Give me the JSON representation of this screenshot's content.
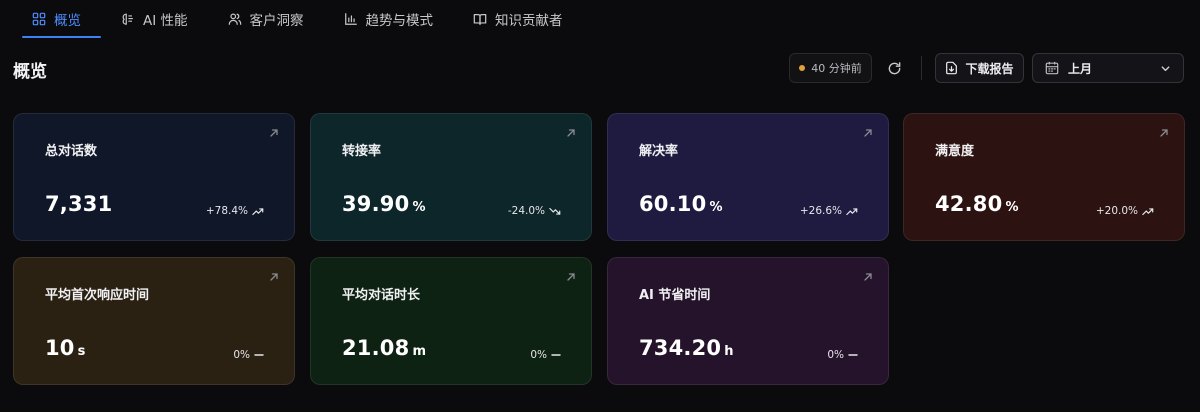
{
  "tabs": [
    {
      "label": "概览",
      "icon": "grid-icon",
      "active": true
    },
    {
      "label": "AI 性能",
      "icon": "brain-icon",
      "active": false
    },
    {
      "label": "客户洞察",
      "icon": "users-icon",
      "active": false
    },
    {
      "label": "趋势与模式",
      "icon": "bar-chart-icon",
      "active": false
    },
    {
      "label": "知识贡献者",
      "icon": "book-icon",
      "active": false
    }
  ],
  "header": {
    "title": "概览",
    "updated": "40 分钟前",
    "download_label": "下载报告",
    "period_value": "上月"
  },
  "colors": {
    "accent": "#3b82f6",
    "status_dot": "#e1a23b"
  },
  "cards": [
    {
      "title": "总对话数",
      "value": "7,331",
      "unit": "",
      "change": "+78.4%",
      "trend": "up",
      "bg": "#0f1729"
    },
    {
      "title": "转接率",
      "value": "39.90",
      "unit": "%",
      "change": "-24.0%",
      "trend": "down",
      "bg": "#0c2629"
    },
    {
      "title": "解决率",
      "value": "60.10",
      "unit": "%",
      "change": "+26.6%",
      "trend": "up",
      "bg": "#1f1a40"
    },
    {
      "title": "满意度",
      "value": "42.80",
      "unit": "%",
      "change": "+20.0%",
      "trend": "up",
      "bg": "#2c1211"
    },
    {
      "title": "平均首次响应时间",
      "value": "10",
      "unit": "s",
      "change": "0%",
      "trend": "flat",
      "bg": "#2b2113"
    },
    {
      "title": "平均对话时长",
      "value": "21.08",
      "unit": "m",
      "change": "0%",
      "trend": "flat",
      "bg": "#0d2212"
    },
    {
      "title": "AI 节省时间",
      "value": "734.20",
      "unit": "h",
      "change": "0%",
      "trend": "flat",
      "bg": "#25122b"
    }
  ]
}
